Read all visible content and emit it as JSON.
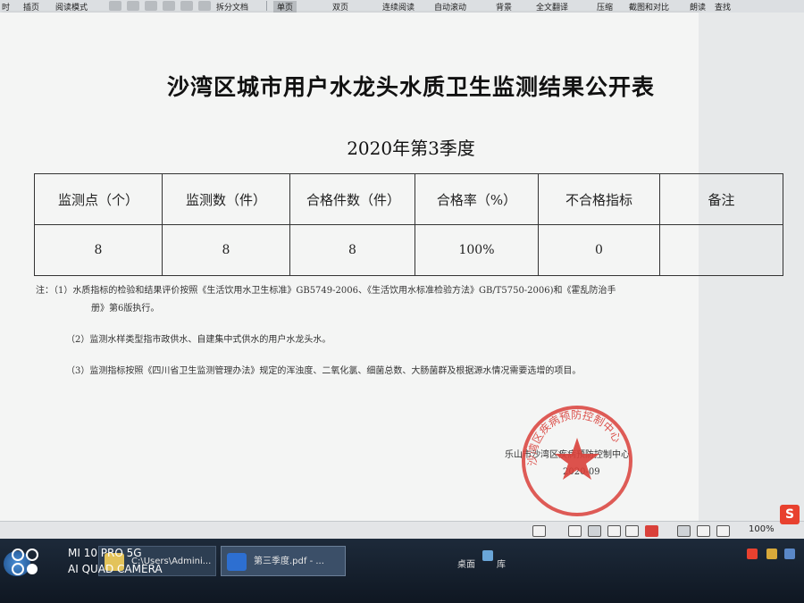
{
  "toolbar": {
    "items": [
      "时",
      "插页",
      "阅读模式",
      "拆分文档",
      "单页",
      "双页",
      "连续阅读",
      "自动滚动",
      "背景",
      "全文翻译",
      "压缩",
      "截图和对比",
      "朗读",
      "查找"
    ]
  },
  "document": {
    "title": "沙湾区城市用户水龙头水质卫生监测结果公开表",
    "subtitle": "2020年第3季度",
    "table": {
      "headers": [
        "监测点（个）",
        "监测数（件）",
        "合格件数（件）",
        "合格率（%）",
        "不合格指标",
        "备注"
      ],
      "row": [
        "8",
        "8",
        "8",
        "100%",
        "0",
        ""
      ]
    },
    "notes": [
      "注：（1）水质指标的检验和结果评价按照《生活饮用水卫生标准》GB5749-2006、《生活饮用水标准检验方法》GB/T5750-2006)和《霍乱防治手",
      "册》第6版执行。",
      "（2）监测水样类型指市政供水、自建集中式供水的用户水龙头水。",
      "（3）监测指标按照《四川省卫生监测管理办法》规定的浑浊度、二氧化氯、细菌总数、大肠菌群及根据源水情况需要选增的项目。"
    ],
    "signature": "乐山市沙湾区疾病预防控制中心",
    "date": "2020-09",
    "seal_text": "沙湾区疾病预防控制中心"
  },
  "statusbar": {
    "zoom": "100%"
  },
  "taskbar": {
    "items": [
      {
        "label": "C:\\Users\\Admini..."
      },
      {
        "label": "第三季度.pdf - ..."
      }
    ],
    "tray": [
      "桌面",
      "库"
    ]
  },
  "watermark": {
    "line1": "MI 10 PRO 5G",
    "line2": "AI QUAD CAMERA"
  },
  "colors": {
    "seal": "#d9403a",
    "page": "#f4f5f4",
    "taskbar": "#15202d"
  }
}
